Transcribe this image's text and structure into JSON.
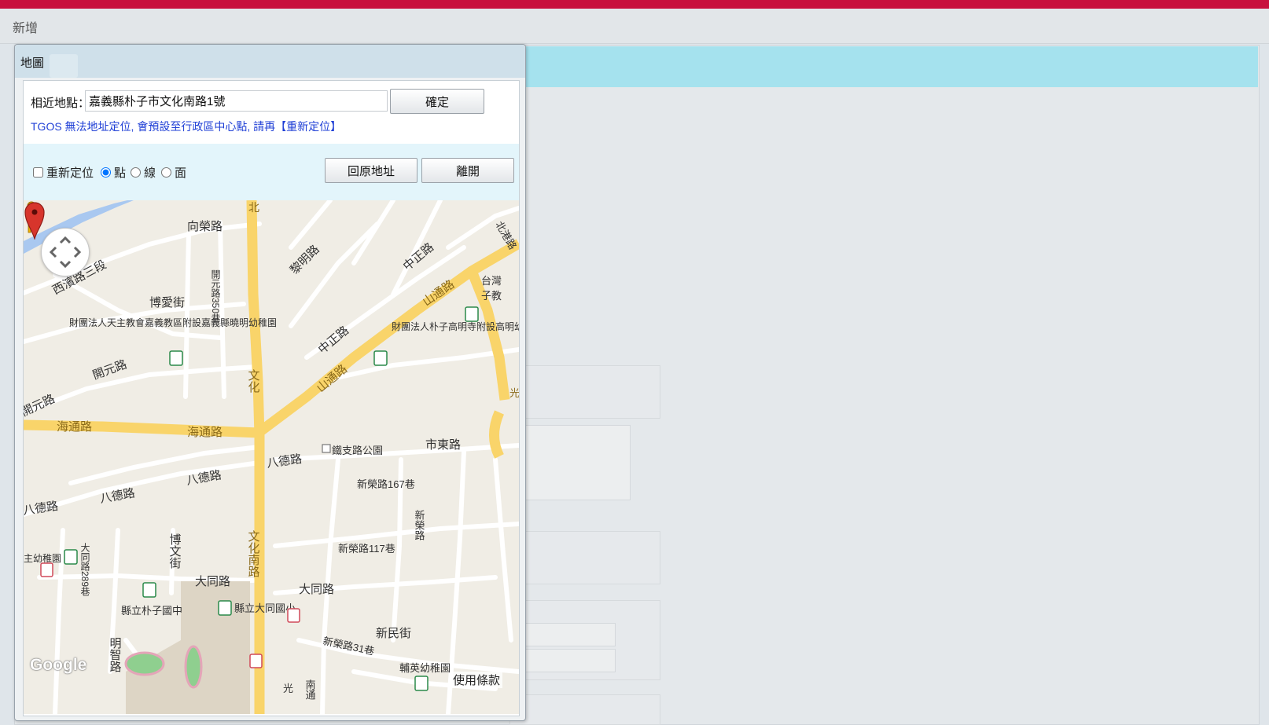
{
  "page": {
    "title": "新增"
  },
  "dialog": {
    "title": "地圖",
    "address_label": "相近地點：",
    "address_value": "嘉義縣朴子市文化南路1號",
    "confirm_label": "確定",
    "note": "TGOS 無法地址定位, 會預設至行政區中心點, 請再【重新定位】",
    "relocate_label": "重新定位",
    "relocate_checked": false,
    "geometry_options": [
      {
        "label": "點",
        "selected": true
      },
      {
        "label": "線",
        "selected": false
      },
      {
        "label": "面",
        "selected": false
      }
    ],
    "restore_label": "回原地址",
    "leave_label": "離開"
  },
  "map": {
    "road_labels": [
      "向榮路",
      "黎明路",
      "中正路",
      "山通路",
      "北港路",
      "台灣",
      "子教",
      "博愛街",
      "開元路350巷",
      "開元路",
      "中正路",
      "山通路",
      "文化",
      "海通路",
      "海通路",
      "開元路",
      "鐵支路公園",
      "市東路",
      "八德路",
      "八德路",
      "八德路",
      "八德路",
      "新榮路167巷",
      "新榮路",
      "新榮路117巷",
      "文化南路",
      "大同路",
      "大同路",
      "博文街",
      "大同路289巷",
      "縣立朴子國中",
      "縣立大同國小",
      "新民街",
      "新榮路31巷",
      "輔英幼稚園",
      "明智路",
      "南通",
      "光",
      "財團法人朴子高明寺附設高明幼稚園",
      "財團法人天主教會嘉義教區附設嘉義縣曉明幼稚園",
      "主幼稚園",
      "西濱路三段",
      "北",
      "光"
    ],
    "attribution": "Google",
    "terms": "使用條款",
    "marker_color": "#d7352c",
    "main_road_color": "#f9d46a"
  }
}
